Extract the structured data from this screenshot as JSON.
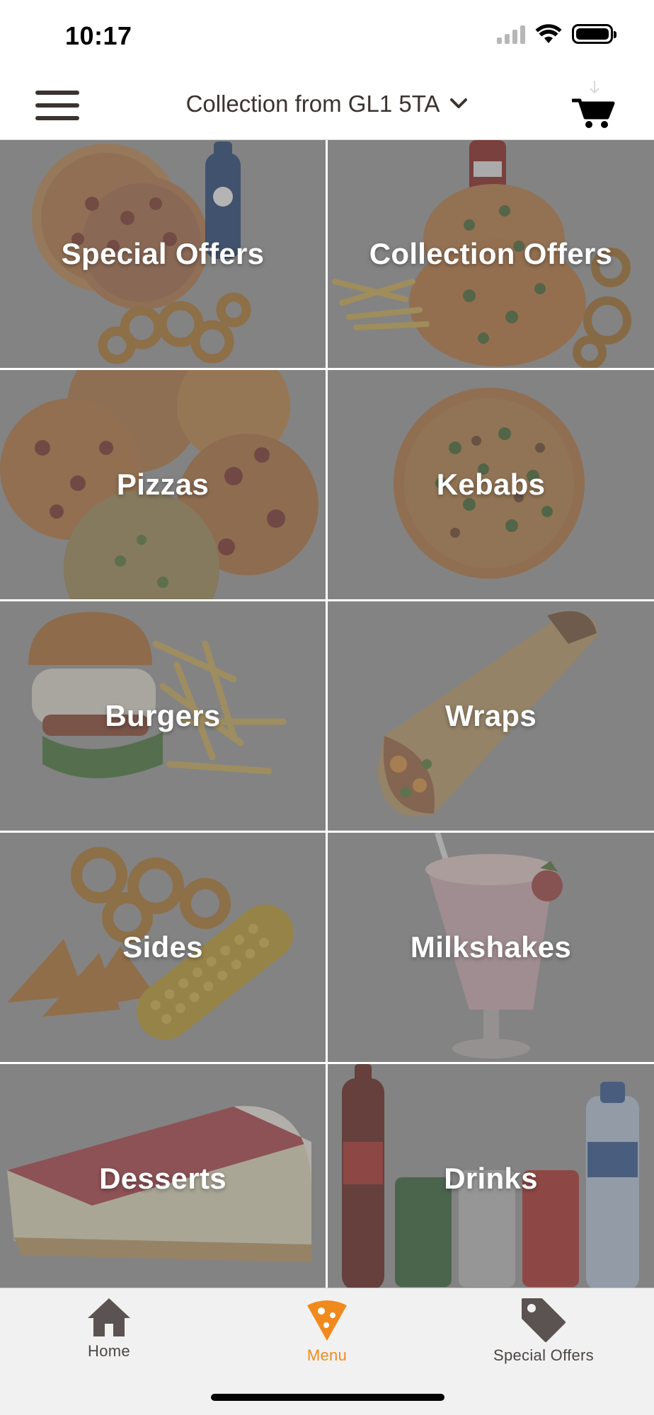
{
  "status_bar": {
    "time": "10:17",
    "signal_icon": "cellular-signal-icon",
    "wifi_icon": "wifi-icon",
    "battery_icon": "battery-icon"
  },
  "header": {
    "menu_icon": "hamburger-menu-icon",
    "location_label": "Collection from GL1 5TA",
    "dropdown_icon": "chevron-down-icon",
    "cart_icon": "shopping-cart-icon"
  },
  "categories": [
    {
      "label": "Special Offers",
      "image": "pizza-onion-rings-pepsi"
    },
    {
      "label": "Collection Offers",
      "image": "pizza-fries-coca-cola"
    },
    {
      "label": "Pizzas",
      "image": "pizzas"
    },
    {
      "label": "Kebabs",
      "image": "kebab-pizza"
    },
    {
      "label": "Burgers",
      "image": "burger-fries"
    },
    {
      "label": "Wraps",
      "image": "wrap"
    },
    {
      "label": "Sides",
      "image": "onion-rings-wedges-corn"
    },
    {
      "label": "Milkshakes",
      "image": "milkshake"
    },
    {
      "label": "Desserts",
      "image": "cheesecake"
    },
    {
      "label": "Drinks",
      "image": "bottles-and-cans"
    }
  ],
  "tab_bar": {
    "active_color": "#f08a1d",
    "inactive_color": "#5b5352",
    "tabs": [
      {
        "label": "Home",
        "icon": "home-icon"
      },
      {
        "label": "Menu",
        "icon": "pizza-slice-icon"
      },
      {
        "label": "Special Offers",
        "icon": "price-tag-icon"
      }
    ]
  }
}
